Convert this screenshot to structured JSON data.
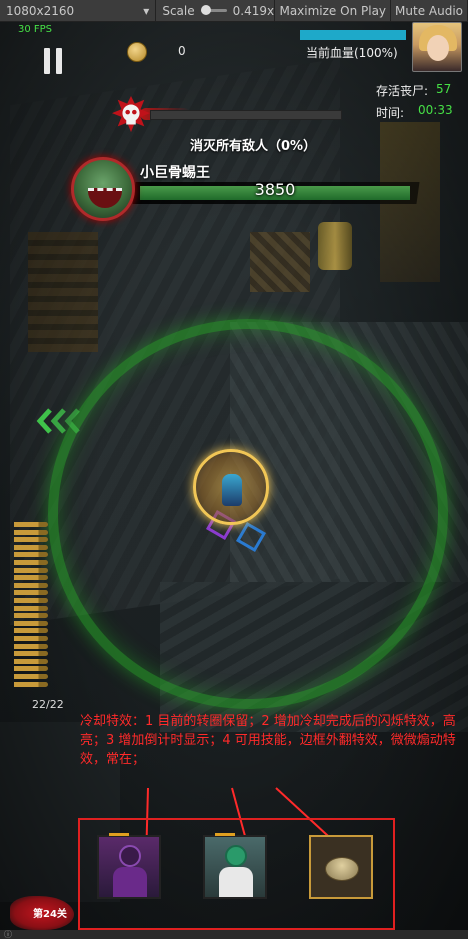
{
  "editor": {
    "resolution": "1080x2160",
    "scale_label": "Scale",
    "scale_value": "0.419x",
    "maximize_label": "Maximize On Play",
    "mute_label": "Mute Audio"
  },
  "hud": {
    "fps": "30 FPS",
    "coins": "0",
    "hp_label": "当前血量(100%)",
    "hp_percent": 100,
    "zombies_label": "存活丧尸:",
    "zombies_value": "57",
    "time_label": "时间:",
    "time_value": "00:33",
    "objective_text": "消灭所有敌人（0%）",
    "objective_percent": 0,
    "boss_name": "小巨骨蜴王",
    "boss_hp": "3850",
    "boss_hp_fraction": 1.0,
    "ammo_count": "22/22",
    "ammo_rounds": 22,
    "level": "第24关"
  },
  "annotation": {
    "text": "冷却特效：1 目前的转圈保留；2 增加冷却完成后的闪烁特效，高亮；3 增加倒计时显示；4 可用技能，边框外翻特效，微微煽动特效，常在；"
  },
  "colors": {
    "annotation": "#ff2a2a",
    "hp": "#1ea9c9",
    "accent_green": "#46e046",
    "boss_hp": "#2e7d32"
  },
  "icons": {
    "pause": "pause-icon",
    "coin": "coin-icon",
    "skull": "skull-icon",
    "direction": "chevron-left-icon"
  }
}
